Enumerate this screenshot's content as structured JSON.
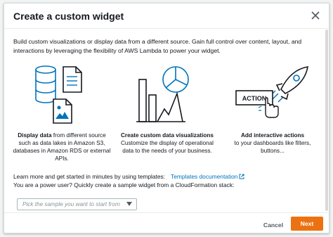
{
  "modal": {
    "title": "Create a custom widget",
    "intro": "Build custom visualizations or display data from a different source. Gain full control over content, layout, and interactions by leveraging the flexibility of AWS Lambda to power your widget."
  },
  "features": [
    {
      "icon": "database-documents-icon",
      "bold": "Display data",
      "text": " from different source such as data lakes in Amazon S3, databases in Amazon RDS or external APIs."
    },
    {
      "icon": "chart-visualization-icon",
      "bold": "Create custom data visualizations",
      "text": "Customize the display of operational data to the needs of your business."
    },
    {
      "icon": "rocket-action-icon",
      "bold": "Add interactive actions",
      "text": "to your dashboards like filters, buttons...",
      "action_label": "ACTION"
    }
  ],
  "learn": {
    "line1": "Learn more and get started in minutes by using templates:",
    "link": "Templates documentation",
    "line2": "You are a power user? Quickly create a sample widget from a CloudFormation stack:"
  },
  "select": {
    "placeholder": "Pick the sample you want to start from"
  },
  "footer": {
    "cancel": "Cancel",
    "next": "Next"
  },
  "colors": {
    "primary": "#ec7211",
    "link": "#0073bb",
    "illustration_blue": "#0073bb",
    "illustration_dark": "#16191f"
  }
}
